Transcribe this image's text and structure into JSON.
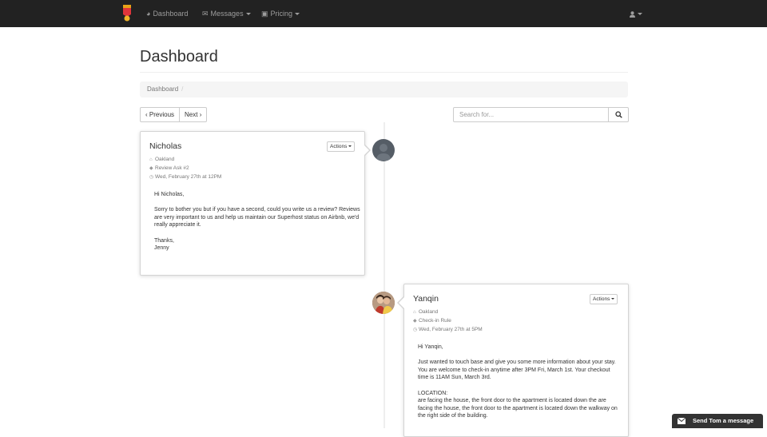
{
  "nav": {
    "items": [
      {
        "icon": "dashboard-icon",
        "label": "Dashboard"
      },
      {
        "icon": "envelope-icon",
        "label": "Messages"
      },
      {
        "icon": "calendar-icon",
        "label": "Pricing"
      }
    ]
  },
  "page": {
    "title": "Dashboard",
    "breadcrumb": [
      "Dashboard",
      "/"
    ]
  },
  "pager": {
    "previous": "‹  Previous",
    "next": "Next  ›"
  },
  "search": {
    "placeholder": "Search for..."
  },
  "timeline": [
    {
      "name": "Nicholas",
      "actions_label": "Actions",
      "location": "Oakland",
      "tag": "Review Ask #2",
      "time": "Wed, February 27th at 12PM",
      "greeting": "Hi Nicholas,",
      "body": "Sorry to bother you but if you have a second, could you write us a review? Reviews are very important to us and help us maintain our Superhost status on Airbnb, we'd really appreciate it.",
      "closing": "Thanks,",
      "signature": "Jenny"
    },
    {
      "name": "Yanqin",
      "actions_label": "Actions",
      "location": "Oakland",
      "tag": "Check-in Rule",
      "time": "Wed, February 27th at 5PM",
      "greeting": "Hi Yanqin,",
      "body": "Just wanted to touch base and give you some more information about your stay.  You are welcome to check-in anytime after 3PM Fri, March 1st. Your checkout time is 11AM Sun, March 3rd.",
      "location_heading": "LOCATION:",
      "location_body": "are facing the house, the front door to the apartment is located down the are facing the house, the front door to the apartment is located down the walkway on the right side of the building."
    }
  ],
  "chat": {
    "label": "Send Tom a message"
  },
  "colors": {
    "navbar": "#222222",
    "nav_text": "#9d9d9d",
    "timeline": "#eeeeee"
  }
}
